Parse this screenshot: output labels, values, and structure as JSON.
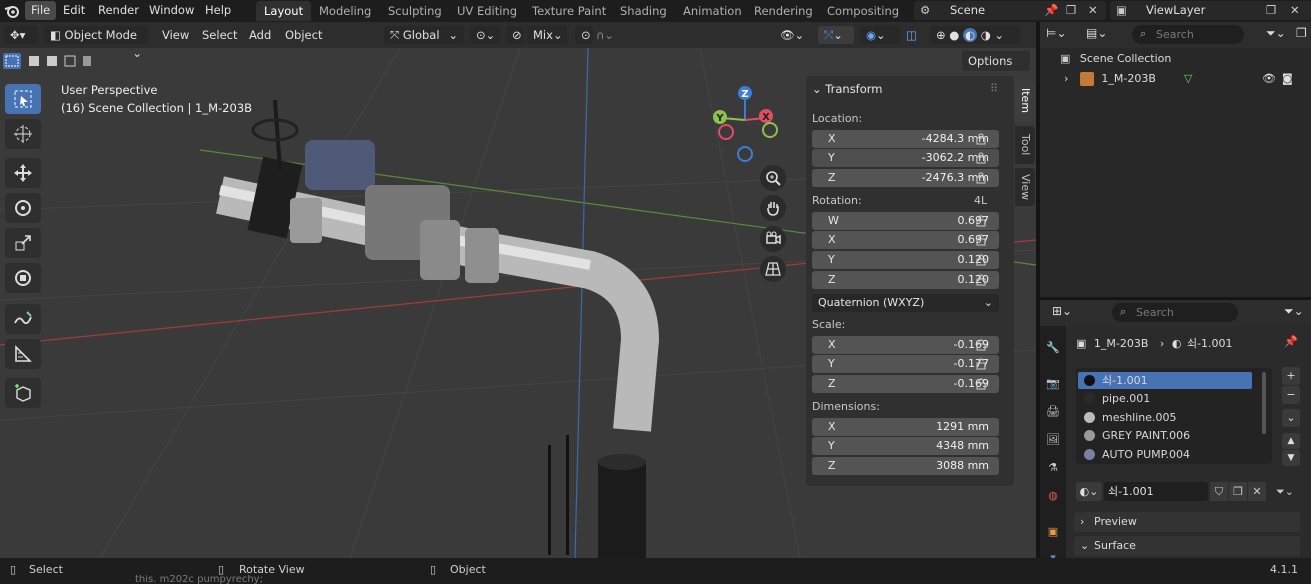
{
  "menu": [
    "File",
    "Edit",
    "Render",
    "Window",
    "Help"
  ],
  "workspaces": [
    "Layout",
    "Modeling",
    "Sculpting",
    "UV Editing",
    "Texture Paint",
    "Shading",
    "Animation",
    "Rendering",
    "Compositing"
  ],
  "scene": {
    "name": "Scene",
    "view_layer": "ViewLayer"
  },
  "viewport_header": {
    "mode": "Object Mode",
    "menus": [
      "View",
      "Select",
      "Add",
      "Object"
    ],
    "orientation": "Global",
    "snap_mode": "Mix",
    "options": "Options"
  },
  "viewport": {
    "perspective": "User Perspective",
    "collection_line": "(16) Scene Collection | 1_M-203B",
    "gizmo_axes": [
      "Z",
      "Y",
      "X"
    ]
  },
  "npanel": {
    "tabs": [
      "Item",
      "Tool",
      "View"
    ],
    "section": "Transform",
    "location_label": "Location:",
    "location": [
      {
        "axis": "X",
        "value": "-4284.3 mm"
      },
      {
        "axis": "Y",
        "value": "-3062.2 mm"
      },
      {
        "axis": "Z",
        "value": "-2476.3 mm"
      }
    ],
    "rotation_label": "Rotation:",
    "rotation_mode_tag": "4L",
    "rotation": [
      {
        "axis": "W",
        "value": "0.697"
      },
      {
        "axis": "X",
        "value": "0.697"
      },
      {
        "axis": "Y",
        "value": "0.120"
      },
      {
        "axis": "Z",
        "value": "0.120"
      }
    ],
    "rotation_mode": "Quaternion (WXYZ)",
    "scale_label": "Scale:",
    "scale": [
      {
        "axis": "X",
        "value": "-0.169"
      },
      {
        "axis": "Y",
        "value": "-0.177"
      },
      {
        "axis": "Z",
        "value": "-0.169"
      }
    ],
    "dimensions_label": "Dimensions:",
    "dimensions": [
      {
        "axis": "X",
        "value": "1291 mm"
      },
      {
        "axis": "Y",
        "value": "4348 mm"
      },
      {
        "axis": "Z",
        "value": "3088 mm"
      }
    ]
  },
  "outliner": {
    "search_placeholder": "Search",
    "root": "Scene Collection",
    "items": [
      "1_M-203B"
    ]
  },
  "properties": {
    "search_placeholder": "Search",
    "breadcrumb_object": "1_M-203B",
    "breadcrumb_material": "쇠-1.001",
    "material_slots": [
      "쇠-1.001",
      "pipe.001",
      "meshline.005",
      "GREY PAINT.006",
      "AUTO PUMP.004"
    ],
    "active_material": "쇠-1.001",
    "panels": [
      "Preview",
      "Surface"
    ]
  },
  "statusbar": {
    "select": "Select",
    "rotate": "Rotate View",
    "object": "Object",
    "version": "4.1.1",
    "code_fragment": "this. m202c pumpyrechy;"
  },
  "colors": {
    "accent": "#4772b3",
    "axis_x": "#e24d62",
    "axis_y": "#8bc34a",
    "axis_z": "#3b7dd8",
    "pipe": "#c9c9c9"
  }
}
